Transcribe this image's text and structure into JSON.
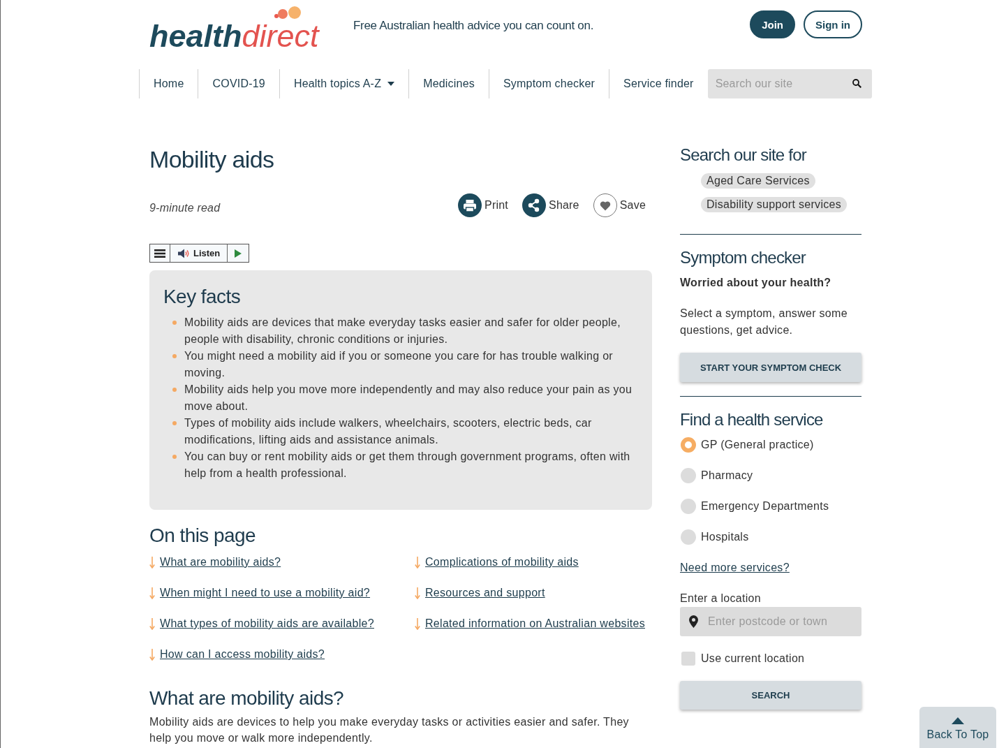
{
  "header": {
    "logo": {
      "part_1": "health",
      "part_2": "direct"
    },
    "tagline": "Free Australian health advice you can count on.",
    "buttons": [
      {
        "label": "Join",
        "kind": "filled"
      },
      {
        "label": "Sign in",
        "kind": "outlined"
      }
    ]
  },
  "nav": {
    "items": [
      {
        "label": "Home",
        "has_menu": false
      },
      {
        "label": "COVID-19",
        "has_menu": false
      },
      {
        "label": "Health topics A-Z",
        "has_menu": true
      },
      {
        "label": "Medicines",
        "has_menu": false
      },
      {
        "label": "Symptom checker",
        "has_menu": false
      },
      {
        "label": "Service finder",
        "has_menu": false
      }
    ],
    "search": {
      "placeholder": "Search our site"
    }
  },
  "article": {
    "title": "Mobility aids",
    "read_time": "9-minute read",
    "actions": [
      {
        "label": "Print",
        "kind": "print"
      },
      {
        "label": "Share",
        "kind": "share"
      },
      {
        "label": "Save",
        "kind": "save"
      }
    ],
    "listen_bar": {
      "label": "Listen"
    },
    "key_facts": {
      "title": "Key facts",
      "items": [
        "Mobility aids are devices that make everyday tasks easier and safer for older people, people with disability, chronic conditions or injuries.",
        "You might need a mobility aid if you or someone you care for has trouble walking or moving.",
        "Mobility aids help you move more independently and may also reduce your pain as you move about.",
        "Types of mobility aids include walkers, wheelchairs, scooters, electric beds, car modifications, lifting aids and assistance animals.",
        "You can buy or rent mobility aids or get them through government programs, often with help from a health professional."
      ]
    },
    "on_this_page": {
      "title": "On this page",
      "links": [
        "What are mobility aids?",
        "When might I need to use a mobility aid?",
        "What types of mobility aids are available?",
        "How can I access mobility aids?",
        "Complications of mobility aids",
        "Resources and support",
        "Related information on Australian websites"
      ]
    },
    "section": {
      "title": "What are mobility aids?",
      "text": "Mobility aids are devices to help you make everyday tasks or activities easier and safer. They help you move or walk more independently."
    }
  },
  "sidebar": {
    "search_for": {
      "title": "Search our site for",
      "tags": [
        "Aged Care Services",
        "Disability support services"
      ]
    },
    "symptom_checker": {
      "title": "Symptom checker",
      "subtitle": "Worried about your health?",
      "text": "Select a symptom, answer some questions, get advice.",
      "button": "START YOUR SYMPTOM CHECK"
    },
    "find_service": {
      "title": "Find a health service",
      "options": [
        {
          "label": "GP (General practice)",
          "selected": true
        },
        {
          "label": "Pharmacy",
          "selected": false
        },
        {
          "label": "Emergency Departments",
          "selected": false
        },
        {
          "label": "Hospitals",
          "selected": false
        }
      ],
      "more_link": "Need more services?",
      "location_label": "Enter a location",
      "location": {
        "placeholder": "Enter postcode or town"
      },
      "use_current_location": {
        "label": "Use current location",
        "checked": false
      },
      "button": "SEARCH"
    }
  },
  "back_to_top": {
    "label": "Back To Top"
  }
}
